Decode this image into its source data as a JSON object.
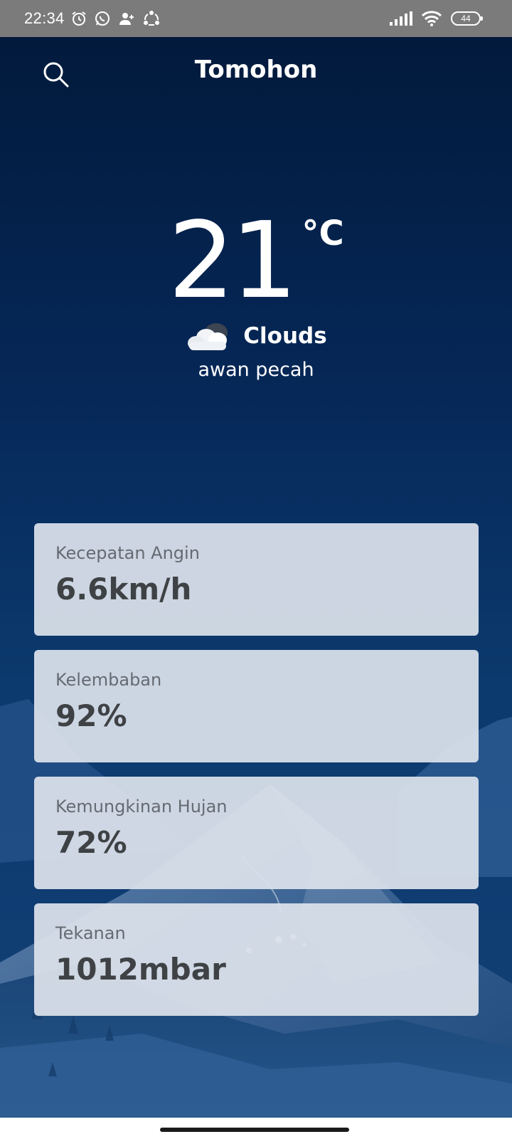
{
  "status_bar": {
    "time": "22:34",
    "battery_level": "44",
    "icons": [
      "alarm-icon",
      "whatsapp-icon",
      "person-add-icon",
      "sync-icon",
      "signal-icon",
      "wifi-icon",
      "battery-icon"
    ]
  },
  "header": {
    "city": "Tomohon",
    "search_icon": "search-icon"
  },
  "weather": {
    "temperature": "21",
    "unit": "°C",
    "condition": "Clouds",
    "condition_icon": "cloud-icon",
    "description": "awan pecah"
  },
  "cards": [
    {
      "label": "Kecepatan Angin",
      "value": "6.6km/h"
    },
    {
      "label": "Kelembaban",
      "value": "92%"
    },
    {
      "label": "Kemungkinan Hujan",
      "value": "72%"
    },
    {
      "label": "Tekanan",
      "value": "1012mbar"
    }
  ],
  "colors": {
    "background_top": "#021a3c",
    "background_bottom": "#123f75",
    "card_background": "#dce2eb",
    "card_label": "#666b73",
    "card_value": "#3f4245",
    "status_bar": "#7b7b7b"
  }
}
